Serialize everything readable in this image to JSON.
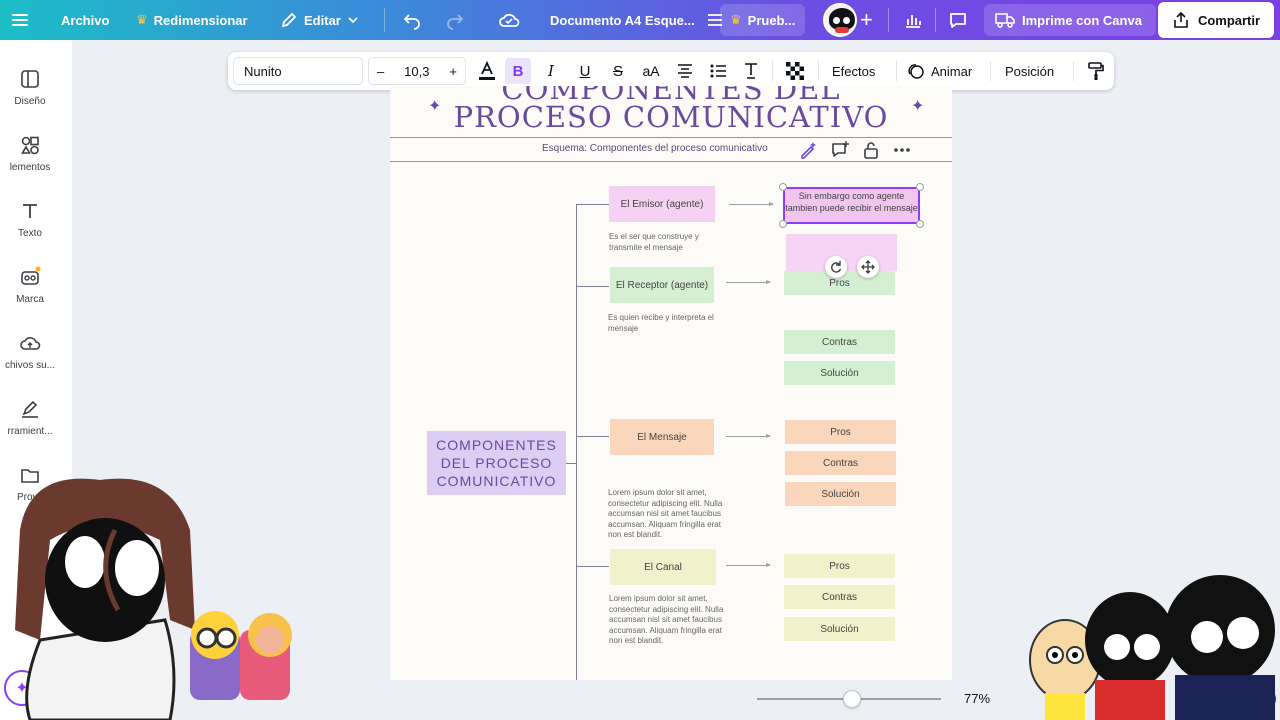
{
  "topbar": {
    "archivo": "Archivo",
    "redimensionar": "Redimensionar",
    "editar": "Editar",
    "doc_title": "Documento A4 Esque...",
    "prueba": "Prueb...",
    "imprime": "Imprime con Canva",
    "compartir": "Compartir"
  },
  "sidebar": {
    "items": [
      {
        "label": "Diseño"
      },
      {
        "label": "lementos"
      },
      {
        "label": "Texto"
      },
      {
        "label": "Marca"
      },
      {
        "label": "chivos su..."
      },
      {
        "label": "rramient..."
      },
      {
        "label": "Proye"
      }
    ]
  },
  "format": {
    "font": "Nunito",
    "size": "10,3",
    "minus": "–",
    "plus": "+",
    "efectos": "Efectos",
    "animar": "Animar",
    "posicion": "Posición"
  },
  "page": {
    "title_line1": "COMPONENTES DEL",
    "title_line2": "PROCESO COMUNICATIVO",
    "subtitle": "Esquema: Componentes del proceso comunicativo",
    "central": "COMPONENTES DEL PROCESO COMUNICATIVO",
    "nodes": {
      "emisor": "El Emisor (agente)",
      "emisor_desc": "Es el ser que construye y transmite el mensaje",
      "receptor": "El Receptor (agente)",
      "receptor_desc": "Es quien recibe y interpreta el mensaje",
      "mensaje": "El Mensaje",
      "mensaje_desc": "Lorem ipsum dolor sit amet, consectetur adipiscing elit. Nulla accumsan nisl sit amet faucibus accumsan. Aliquam fringilla erat non est blandit.",
      "canal": "El Canal",
      "canal_desc": "Lorem ipsum dolor sit amet, consectetur adipiscing elit. Nulla accumsan nisl sit amet faucibus accumsan. Aliquam fringilla erat non est blandit."
    },
    "selected_text": "Sin embargo como agente tambien puede recibir el mensaje",
    "pills": {
      "pros": "Pros",
      "contras": "Contras",
      "solucion": "Solución"
    }
  },
  "zoom": "77%",
  "help": "?"
}
